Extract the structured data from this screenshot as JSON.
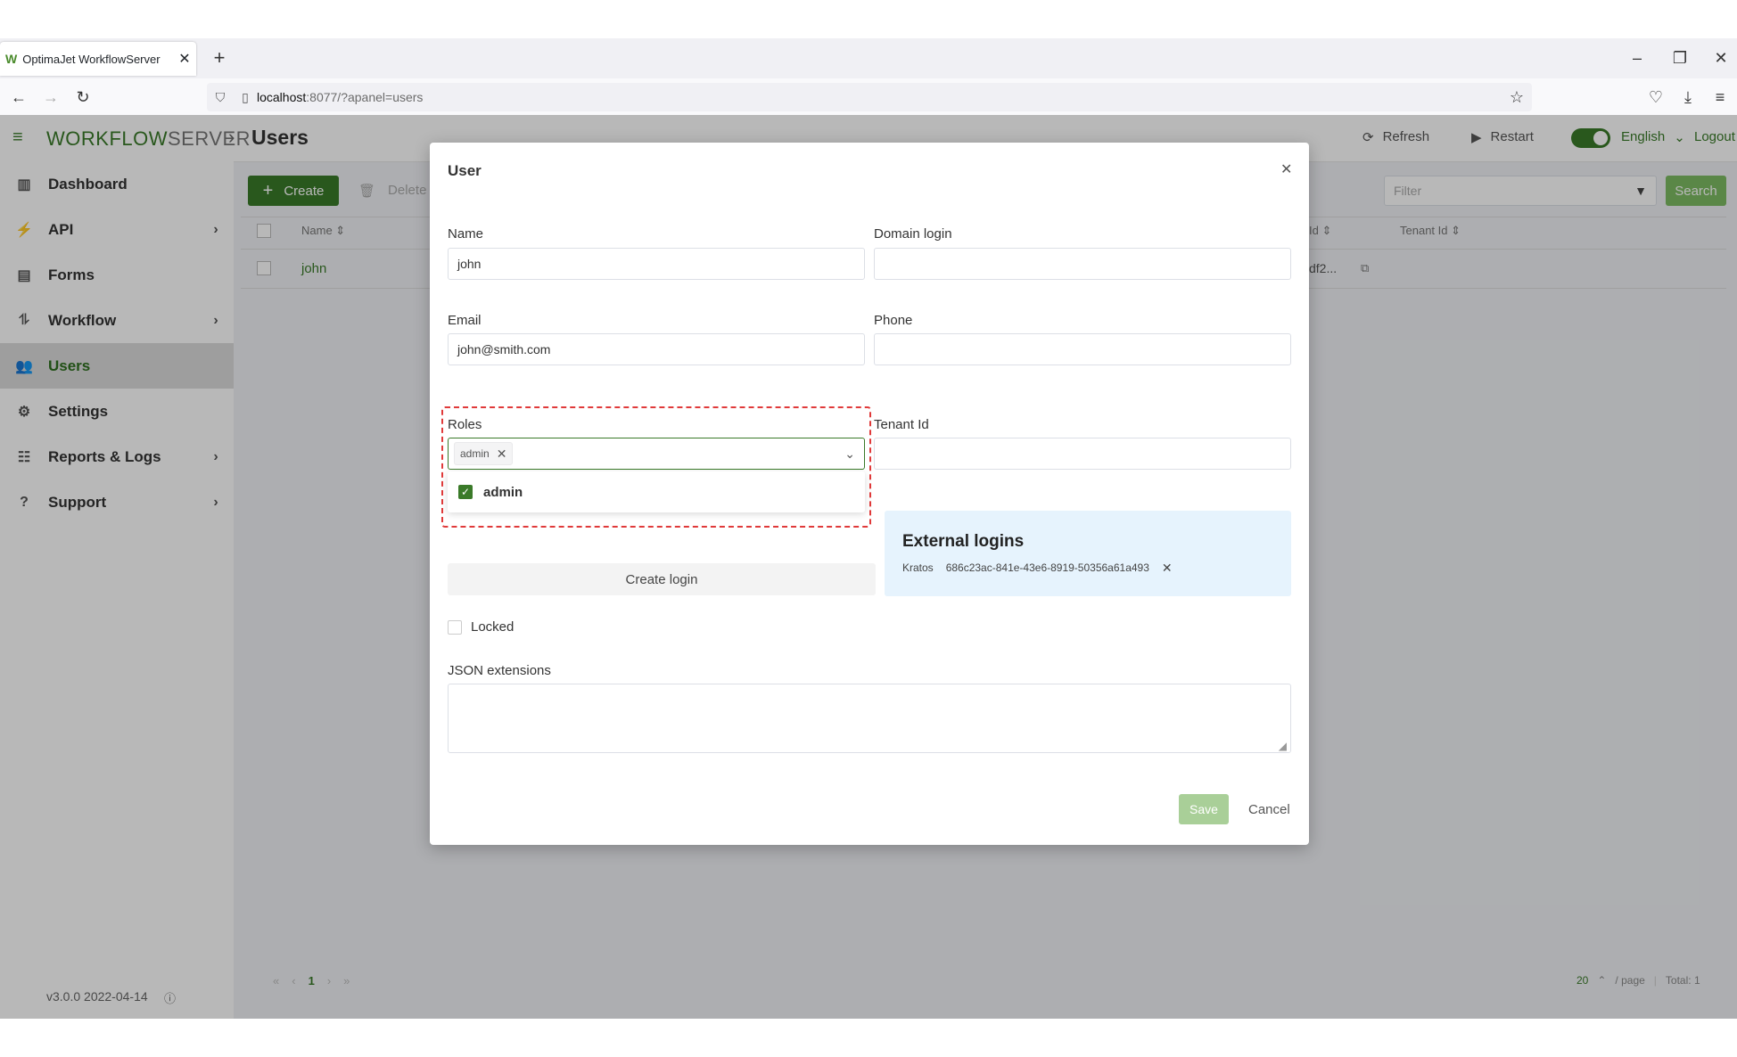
{
  "browser": {
    "tab_title": "OptimaJet WorkflowServer",
    "url_host": "localhost",
    "url_rest": ":8077/?apanel=users"
  },
  "app": {
    "logo_text": "WORKFLOW",
    "logo_text_2": "SERVER",
    "page_title": "Users",
    "refresh_label": "Refresh",
    "restart_label": "Restart",
    "language": "English",
    "logout_label": "Logout",
    "version": "v3.0.0 2022-04-14"
  },
  "sidebar": {
    "items": [
      {
        "label": "Dashboard",
        "icon": "dashboard-icon"
      },
      {
        "label": "API",
        "icon": "plug-icon"
      },
      {
        "label": "Forms",
        "icon": "form-icon"
      },
      {
        "label": "Workflow",
        "icon": "workflow-icon"
      },
      {
        "label": "Users",
        "icon": "users-icon"
      },
      {
        "label": "Settings",
        "icon": "gear-icon"
      },
      {
        "label": "Reports & Logs",
        "icon": "reports-icon"
      },
      {
        "label": "Support",
        "icon": "help-icon"
      }
    ]
  },
  "toolbar": {
    "create_label": "Create",
    "delete_label": "Delete",
    "filter_placeholder": "Filter",
    "search_label": "Search"
  },
  "table": {
    "columns": [
      "Name",
      "Id",
      "Tenant Id"
    ],
    "rows": [
      {
        "name": "john",
        "id_fragment": "df2..."
      }
    ]
  },
  "pagination": {
    "current_page": "1",
    "page_size": "20",
    "per_page_label": "/ page",
    "total_label": "Total: 1"
  },
  "modal": {
    "title": "User",
    "name_label": "Name",
    "name_value": "john",
    "domain_login_label": "Domain login",
    "domain_login_value": "",
    "email_label": "Email",
    "email_value": "john@smith.com",
    "phone_label": "Phone",
    "phone_value": "",
    "roles_label": "Roles",
    "roles_selected": "admin",
    "roles_option": "admin",
    "tenant_label": "Tenant Id",
    "tenant_value": "",
    "external_logins_title": "External logins",
    "external_provider": "Kratos",
    "external_id": "686c23ac-841e-43e6-8919-50356a61a493",
    "create_login_label": "Create login",
    "locked_label": "Locked",
    "json_label": "JSON extensions",
    "json_value": "",
    "save_label": "Save",
    "cancel_label": "Cancel"
  },
  "colors": {
    "brand_green": "#3a7a29",
    "active_text": "#2e6f1f",
    "highlight_dash": "#e03a3a",
    "external_bg": "#e6f3fd"
  }
}
